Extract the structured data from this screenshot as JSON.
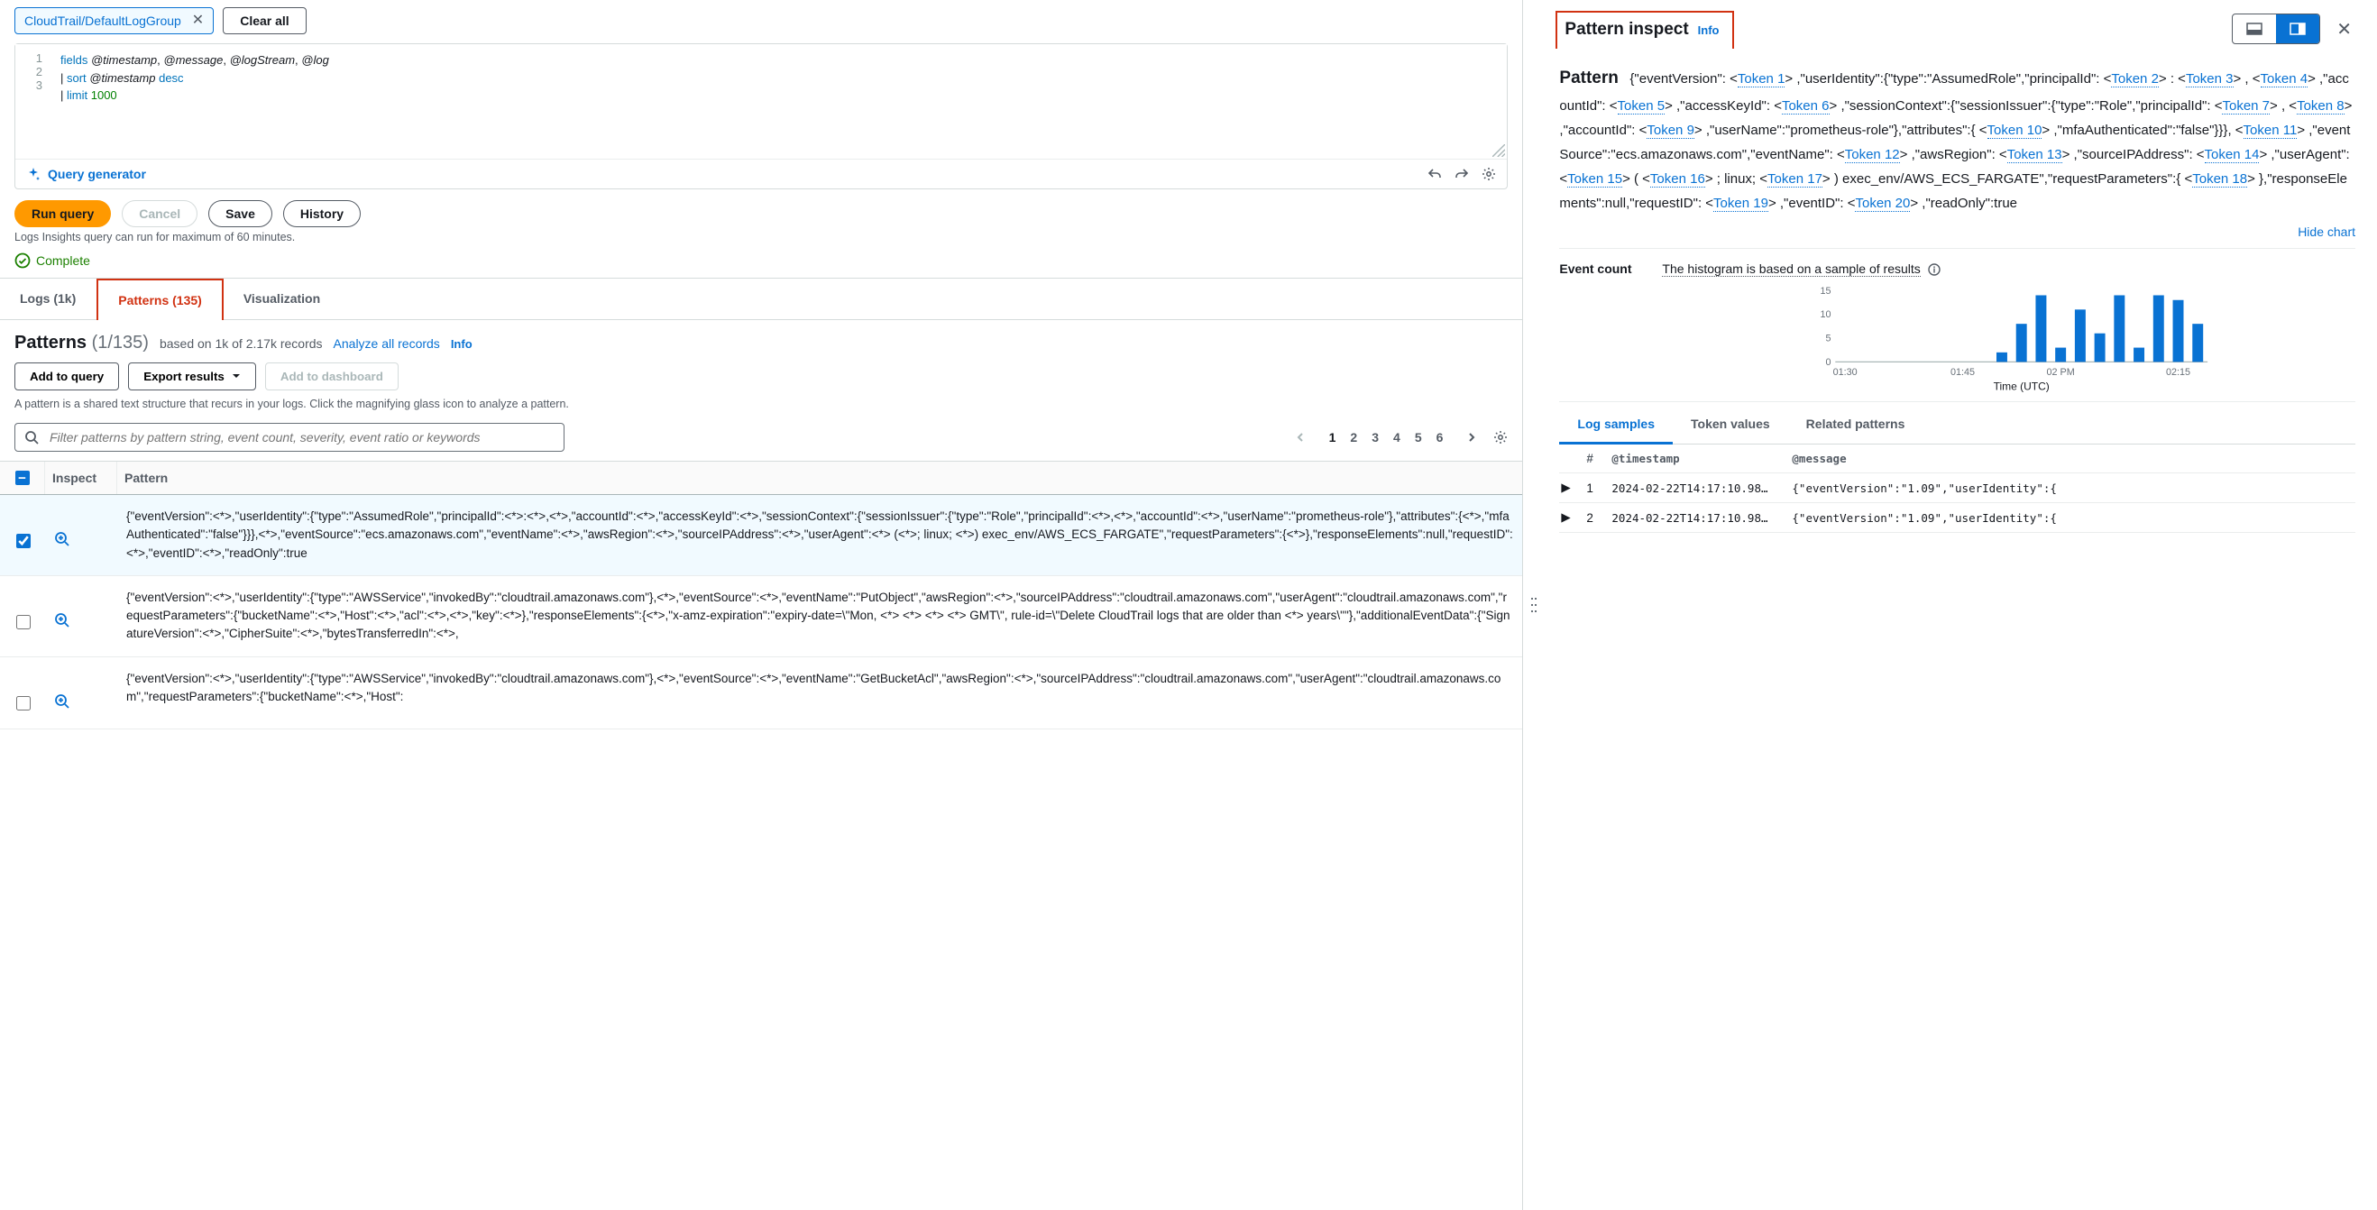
{
  "topbar": {
    "log_group_tag": "CloudTrail/DefaultLogGroup",
    "clear_all": "Clear all"
  },
  "editor": {
    "lines": [
      {
        "n": 1,
        "raw": "fields @timestamp, @message, @logStream, @log",
        "rendered": "<span class='kw'>fields</span> <span class='var'>@timestamp</span>, <span class='var'>@message</span>, <span class='var'>@logStream</span>, <span class='var'>@log</span>"
      },
      {
        "n": 2,
        "raw": "| sort @timestamp desc",
        "rendered": "| <span class='kw'>sort</span> <span class='var'>@timestamp</span> <span class='id'>desc</span>"
      },
      {
        "n": 3,
        "raw": "| limit 1000",
        "rendered": "| <span class='kw'>limit</span> <span class='num'>1000</span>"
      }
    ],
    "generator": "Query generator"
  },
  "actions": {
    "run": "Run query",
    "cancel": "Cancel",
    "save": "Save",
    "history": "History"
  },
  "hint": "Logs Insights query can run for maximum of 60 minutes.",
  "status": {
    "text": "Complete"
  },
  "tabs": {
    "logs": "Logs (1k)",
    "patterns": "Patterns (135)",
    "viz": "Visualization"
  },
  "patterns": {
    "title": "Patterns",
    "count": "(1/135)",
    "based": "based on 1k of 2.17k records",
    "analyze": "Analyze all records",
    "info": "Info",
    "add_to_query": "Add to query",
    "export": "Export results",
    "add_dash": "Add to dashboard",
    "note": "A pattern is a shared text structure that recurs in your logs. Click the magnifying glass icon to analyze a pattern.",
    "filter_placeholder": "Filter patterns by pattern string, event count, severity, event ratio or keywords",
    "pages": [
      "1",
      "2",
      "3",
      "4",
      "5",
      "6"
    ]
  },
  "columns": {
    "inspect": "Inspect",
    "pattern": "Pattern"
  },
  "rows": [
    {
      "selected": true,
      "text": "{\"eventVersion\":<*>,\"userIdentity\":{\"type\":\"AssumedRole\",\"principalId\":<*>:<*>,<*>,\"accountId\":<*>,\"accessKeyId\":<*>,\"sessionContext\":{\"sessionIssuer\":{\"type\":\"Role\",\"principalId\":<*>,<*>,\"accountId\":<*>,\"userName\":\"prometheus-role\"},\"attributes\":{<*>,\"mfaAuthenticated\":\"false\"}}},<*>,\"eventSource\":\"ecs.amazonaws.com\",\"eventName\":<*>,\"awsRegion\":<*>,\"sourceIPAddress\":<*>,\"userAgent\":<*> (<*>; linux; <*>) exec_env/AWS_ECS_FARGATE\",\"requestParameters\":{<*>},\"responseElements\":null,\"requestID\":<*>,\"eventID\":<*>,\"readOnly\":true"
    },
    {
      "selected": false,
      "text": "{\"eventVersion\":<*>,\"userIdentity\":{\"type\":\"AWSService\",\"invokedBy\":\"cloudtrail.amazonaws.com\"},<*>,\"eventSource\":<*>,\"eventName\":\"PutObject\",\"awsRegion\":<*>,\"sourceIPAddress\":\"cloudtrail.amazonaws.com\",\"userAgent\":\"cloudtrail.amazonaws.com\",\"requestParameters\":{\"bucketName\":<*>,\"Host\":<*>,\"acl\":<*>,<*>,\"key\":<*>},\"responseElements\":{<*>,\"x-amz-expiration\":\"expiry-date=\\\"Mon, <*> <*> <*> <*> GMT\\\", rule-id=\\\"Delete CloudTrail logs that are older than <*> years\\\"\"},\"additionalEventData\":{\"SignatureVersion\":<*>,\"CipherSuite\":<*>,\"bytesTransferredIn\":<*>,"
    },
    {
      "selected": false,
      "text": "{\"eventVersion\":<*>,\"userIdentity\":{\"type\":\"AWSService\",\"invokedBy\":\"cloudtrail.amazonaws.com\"},<*>,\"eventSource\":<*>,\"eventName\":\"GetBucketAcl\",\"awsRegion\":<*>,\"sourceIPAddress\":\"cloudtrail.amazonaws.com\",\"userAgent\":\"cloudtrail.amazonaws.com\",\"requestParameters\":{\"bucketName\":<*>,\"Host\":"
    }
  ],
  "inspect": {
    "title": "Pattern inspect",
    "info": "Info",
    "pattern_title": "Pattern",
    "segments": [
      "{\"eventVersion\": <",
      "Token 1",
      ">",
      " ,\"userIdentity\":{\"type\":\"AssumedRole\",\"principalId\": <",
      "Token 2",
      "> : <",
      "Token 3",
      "> , <",
      "Token 4",
      "> ,\"accountId\": <",
      "Token 5",
      "> ,\"accessKeyId\": <",
      "Token 6",
      ">",
      " ,\"sessionContext\":{\"sessionIssuer\":{\"type\":\"Role\",\"principalId\": <",
      "Token 7",
      "> , <",
      "Token 8",
      "> ,\"accountId\": <",
      "Token 9",
      ">",
      " ,\"userName\":\"prometheus-role\"},\"attributes\":{ <",
      "Token 10",
      "> ,\"mfaAuthenticated\":\"false\"}}}, <",
      "Token 11",
      ">",
      " ,\"eventSource\":\"ecs.amazonaws.com\",\"eventName\": <",
      "Token 12",
      ">",
      " ,\"awsRegion\": <",
      "Token 13",
      "> ,\"sourceIPAddress\": <",
      "Token 14",
      "> ,\"userAgent\": <",
      "Token 15",
      "> ( <",
      "Token 16",
      "> ; linux; <",
      "Token 17",
      ">",
      " ) exec_env/AWS_ECS_FARGATE\",\"requestParameters\":{ <",
      "Token 18",
      "> },\"responseElements\":null,\"requestID\": <",
      "Token 19",
      "> ,\"eventID\": <",
      "Token 20",
      "> ,\"readOnly\":true"
    ],
    "hide_chart": "Hide chart",
    "event_count_label": "Event count",
    "hist_note": "The histogram is based on a sample of results",
    "rp_tabs": {
      "samples": "Log samples",
      "tokens": "Token values",
      "related": "Related patterns"
    },
    "sample_headers": {
      "num": "#",
      "ts": "@timestamp",
      "msg": "@message"
    },
    "samples": [
      {
        "n": 1,
        "ts": "2024-02-22T14:17:10.98…",
        "msg": "{\"eventVersion\":\"1.09\",\"userIdentity\":{"
      },
      {
        "n": 2,
        "ts": "2024-02-22T14:17:10.98…",
        "msg": "{\"eventVersion\":\"1.09\",\"userIdentity\":{"
      }
    ]
  },
  "chart_data": {
    "type": "bar",
    "xlabel": "Time (UTC)",
    "ylabel": "",
    "ylim": [
      0,
      15
    ],
    "yticks": [
      0,
      5,
      10,
      15
    ],
    "x_ticks": [
      "01:30",
      "01:45",
      "02 PM",
      "02:15"
    ],
    "categories": [
      "01:30",
      "01:33",
      "01:36",
      "01:39",
      "01:42",
      "01:45",
      "01:48",
      "01:51",
      "01:55",
      "01:58",
      "02:00",
      "02:02",
      "02:05",
      "02:07",
      "02:10",
      "02:13",
      "02:15",
      "02:18",
      "02:21"
    ],
    "values": [
      0,
      0,
      0,
      0,
      0,
      0,
      0,
      0,
      2,
      8,
      14,
      3,
      11,
      6,
      14,
      3,
      14,
      13,
      8
    ]
  }
}
